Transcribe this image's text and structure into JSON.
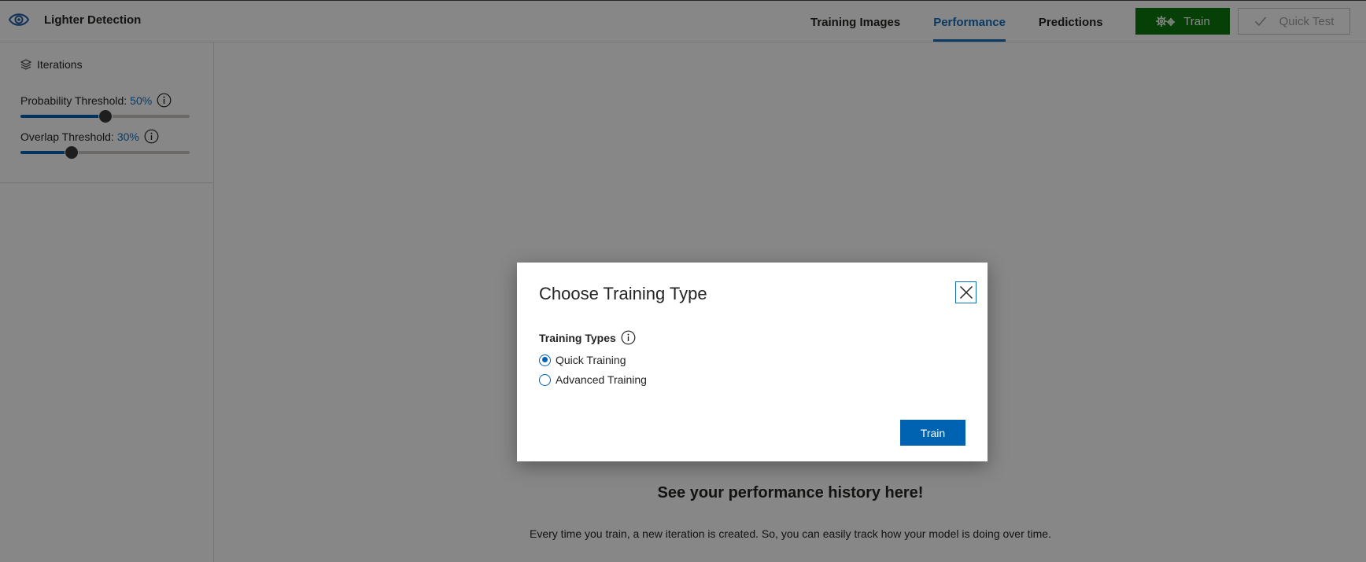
{
  "header": {
    "app_name": "Lighter Detection",
    "tabs": [
      {
        "label": "Training Images",
        "active": false
      },
      {
        "label": "Performance",
        "active": true
      },
      {
        "label": "Predictions",
        "active": false
      }
    ],
    "train_label": "Train",
    "quick_test_label": "Quick Test"
  },
  "sidebar": {
    "iterations_label": "Iterations",
    "probability": {
      "label": "Probability Threshold:",
      "value_text": "50%",
      "value": 50
    },
    "overlap": {
      "label": "Overlap Threshold:",
      "value_text": "30%",
      "value": 30
    }
  },
  "main": {
    "history_title": "See your performance history here!",
    "history_desc": "Every time you train, a new iteration is created. So, you can easily track how your model is doing over time."
  },
  "dialog": {
    "title": "Choose Training Type",
    "section_label": "Training Types",
    "options": [
      {
        "label": "Quick Training",
        "selected": true
      },
      {
        "label": "Advanced Training",
        "selected": false
      }
    ],
    "train_button": "Train"
  },
  "colors": {
    "accent": "#106ebe",
    "train_green": "#0e7a0d",
    "slider_fill": "#0063b1"
  }
}
